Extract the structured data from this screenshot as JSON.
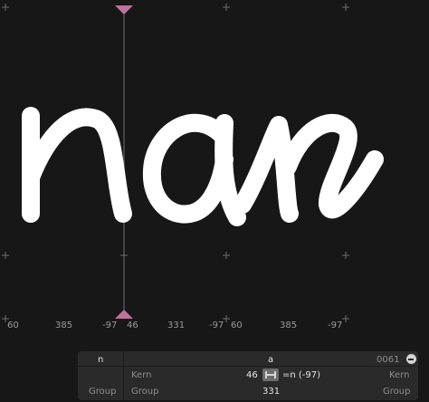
{
  "glyph_text": "nan",
  "metrics": [
    "60",
    "385",
    "-97",
    "46",
    "331",
    "-97",
    "60",
    "385",
    "-97"
  ],
  "panel": {
    "glyph_left": "n",
    "glyph_right": "a",
    "unicode_code": "0061",
    "kern_label_left": "Kern",
    "kern_label_right": "Kern",
    "kern_value": "46",
    "kern_expr": "=n (-97)",
    "group_left_a": "Group",
    "group_left_b": "Group",
    "group_right": "Group",
    "width_value": "331"
  },
  "colors": {
    "background": "#171717",
    "glyph_fill": "#ffffff",
    "cursor_marker": "#c0729a",
    "guide_cross": "#6e6e6e"
  },
  "icons": [
    "cursor-top-triangle-icon",
    "cursor-bottom-triangle-icon",
    "code-arrow-icon",
    "kern-lock-icon"
  ]
}
